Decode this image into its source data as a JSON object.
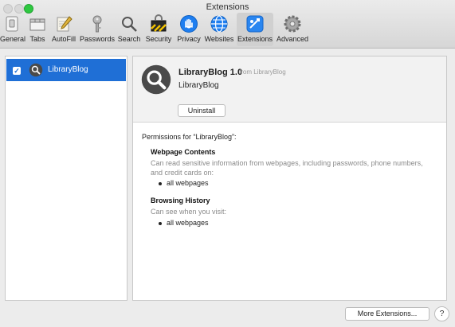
{
  "window": {
    "title": "Extensions"
  },
  "toolbar": {
    "items": [
      {
        "label": "General",
        "icon": "general-switch-icon"
      },
      {
        "label": "Tabs",
        "icon": "tabs-icon"
      },
      {
        "label": "AutoFill",
        "icon": "autofill-pencil-icon"
      },
      {
        "label": "Passwords",
        "icon": "key-icon"
      },
      {
        "label": "Search",
        "icon": "search-icon"
      },
      {
        "label": "Security",
        "icon": "security-icon"
      },
      {
        "label": "Privacy",
        "icon": "privacy-hand-icon"
      },
      {
        "label": "Websites",
        "icon": "globe-icon"
      },
      {
        "label": "Extensions",
        "icon": "puzzle-icon",
        "active": true
      },
      {
        "label": "Advanced",
        "icon": "gear-icon"
      }
    ]
  },
  "extensions_list": {
    "items": [
      {
        "label": "LibraryBlog",
        "enabled": true,
        "selected": true,
        "icon": "magnifier-icon"
      }
    ]
  },
  "detail": {
    "name": "LibraryBlog 1.0",
    "from": "from LibraryBlog",
    "subtitle": "LibraryBlog",
    "uninstall_label": "Uninstall",
    "permissions_title": "Permissions for “LibraryBlog”:",
    "sections": [
      {
        "title": "Webpage Contents",
        "description": "Can read sensitive information from webpages, including passwords, phone numbers, and credit cards on:",
        "items": [
          "all webpages"
        ]
      },
      {
        "title": "Browsing History",
        "description": "Can see when you visit:",
        "items": [
          "all webpages"
        ]
      }
    ]
  },
  "footer": {
    "more_label": "More Extensions...",
    "help_label": "?"
  },
  "colors": {
    "selection": "#1f6fd6",
    "window_bg": "#ececec",
    "muted_text": "#8a8a8a"
  }
}
